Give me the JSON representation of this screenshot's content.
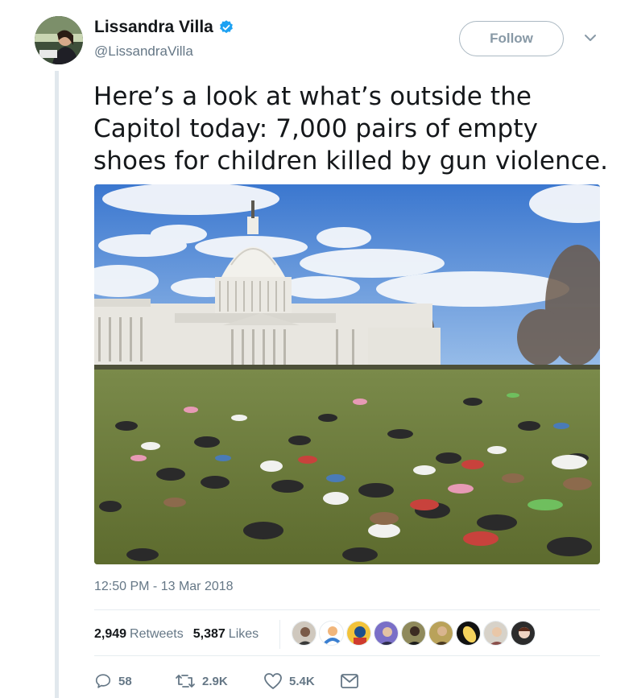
{
  "author": {
    "name": "Lissandra Villa",
    "handle": "@LissandraVilla",
    "verified": true
  },
  "header": {
    "follow_label": "Follow"
  },
  "tweet": {
    "text": "Here’s a look at what’s outside the Capitol today: 7,000 pairs of empty shoes for children killed by gun violence.",
    "timestamp": "12:50 PM - 13 Mar 2018"
  },
  "stats": {
    "retweets_count": "2,949",
    "retweets_label": "Retweets",
    "likes_count": "5,387",
    "likes_label": "Likes"
  },
  "actions": {
    "reply_count": "58",
    "retweet_count": "2.9K",
    "like_count": "5.4K"
  },
  "icons": {
    "verified": "verified-badge-icon",
    "caret": "chevron-down-icon",
    "reply": "reply-icon",
    "retweet": "retweet-icon",
    "like": "heart-icon",
    "message": "envelope-icon"
  },
  "colors": {
    "verified_blue": "#1da1f2",
    "muted_text": "#657786",
    "follow_border": "#aab8c2"
  }
}
